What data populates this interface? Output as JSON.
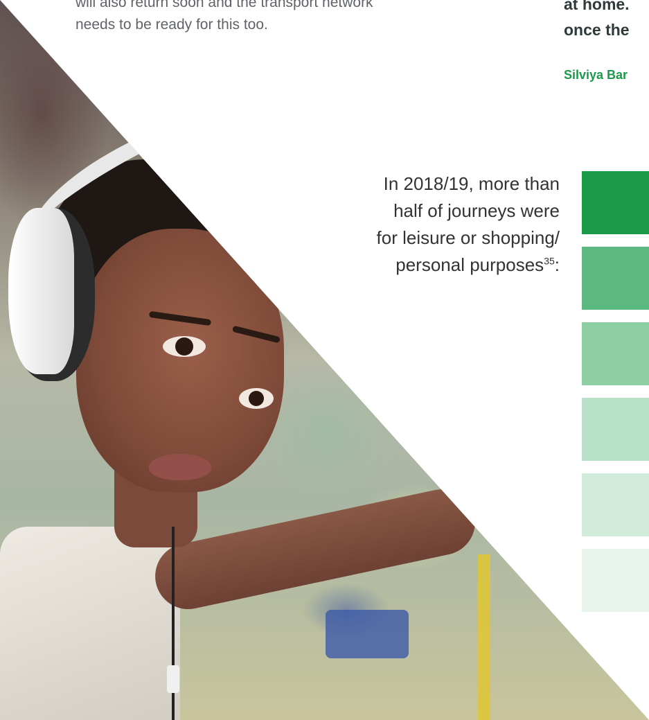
{
  "intro": {
    "line1": "will also return soon and the transport network",
    "line2": "needs to be ready for this too."
  },
  "quote": {
    "line1": "at home.",
    "line2": "once the",
    "author": "Silviya Bar"
  },
  "stat": {
    "line1": "In 2018/19, more than",
    "line2": "half of journeys were",
    "line3": "for leisure or shopping/",
    "line4": "personal purposes",
    "footnote": "35",
    "trailing": ":"
  },
  "key_blocks": [
    {
      "color": "#1b9a4a"
    },
    {
      "color": "#5bb87e"
    },
    {
      "color": "#8dcfa3"
    },
    {
      "color": "#b8e1c7"
    },
    {
      "color": "#d2ecdc"
    },
    {
      "color": "#e7f5ec"
    }
  ]
}
